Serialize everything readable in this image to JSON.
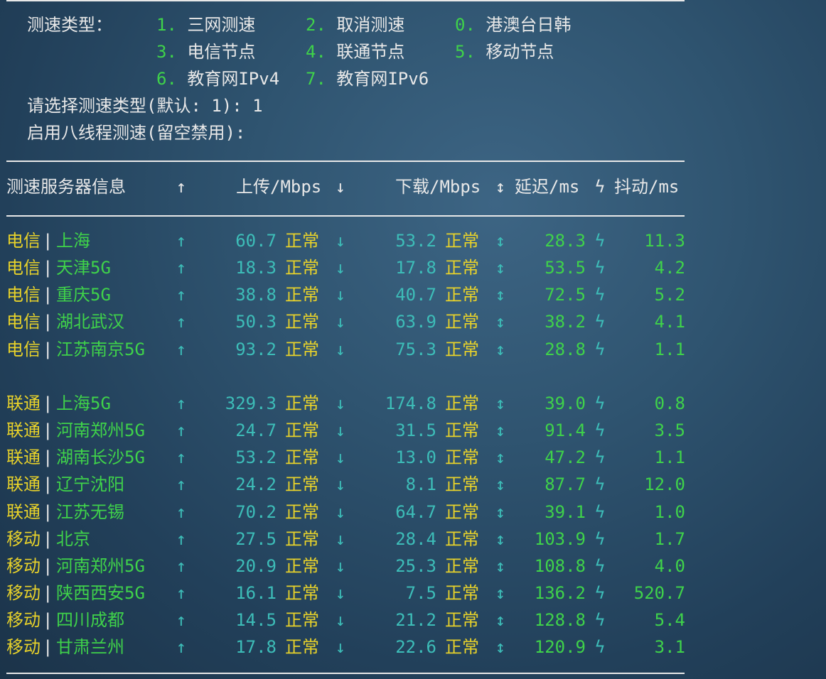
{
  "menu": {
    "label": "测速类型：",
    "options": [
      {
        "key": "1.",
        "text": "三网测速"
      },
      {
        "key": "2.",
        "text": "取消测速"
      },
      {
        "key": "0.",
        "text": "港澳台日韩"
      },
      {
        "key": "3.",
        "text": "电信节点"
      },
      {
        "key": "4.",
        "text": "联通节点"
      },
      {
        "key": "5.",
        "text": "移动节点"
      },
      {
        "key": "6.",
        "text": "教育网IPv4"
      },
      {
        "key": "7.",
        "text": "教育网IPv6"
      }
    ],
    "prompt_select": "请选择测速类型(默认: 1): 1",
    "prompt_threads": "启用八线程测速(留空禁用):"
  },
  "table": {
    "headers": {
      "server": "测速服务器信息",
      "up_icon": "↑",
      "upload": "上传/Mbps",
      "down_icon": "↓",
      "download": "下载/Mbps",
      "lat_icon": "↕",
      "latency": "延迟/ms",
      "jit_icon": "ϟ",
      "jitter": "抖动/ms"
    },
    "status_text": "正常",
    "groups": [
      {
        "rows": [
          {
            "isp": "电信",
            "node": "上海",
            "up": "60.7",
            "down": "53.2",
            "lat": "28.3",
            "jit": "11.3"
          },
          {
            "isp": "电信",
            "node": "天津5G",
            "up": "18.3",
            "down": "17.8",
            "lat": "53.5",
            "jit": "4.2"
          },
          {
            "isp": "电信",
            "node": "重庆5G",
            "up": "38.8",
            "down": "40.7",
            "lat": "72.5",
            "jit": "5.2"
          },
          {
            "isp": "电信",
            "node": "湖北武汉",
            "up": "50.3",
            "down": "63.9",
            "lat": "38.2",
            "jit": "4.1"
          },
          {
            "isp": "电信",
            "node": "江苏南京5G",
            "up": "93.2",
            "down": "75.3",
            "lat": "28.8",
            "jit": "1.1"
          }
        ]
      },
      {
        "rows": [
          {
            "isp": "联通",
            "node": "上海5G",
            "up": "329.3",
            "down": "174.8",
            "lat": "39.0",
            "jit": "0.8"
          },
          {
            "isp": "联通",
            "node": "河南郑州5G",
            "up": "24.7",
            "down": "31.5",
            "lat": "91.4",
            "jit": "3.5"
          },
          {
            "isp": "联通",
            "node": "湖南长沙5G",
            "up": "53.2",
            "down": "13.0",
            "lat": "47.2",
            "jit": "1.1"
          },
          {
            "isp": "联通",
            "node": "辽宁沈阳",
            "up": "24.2",
            "down": "8.1",
            "lat": "87.7",
            "jit": "12.0"
          },
          {
            "isp": "联通",
            "node": "江苏无锡",
            "up": "70.2",
            "down": "64.7",
            "lat": "39.1",
            "jit": "1.0"
          },
          {
            "isp": "移动",
            "node": "北京",
            "up": "27.5",
            "down": "28.4",
            "lat": "103.9",
            "jit": "1.7"
          },
          {
            "isp": "移动",
            "node": "河南郑州5G",
            "up": "20.9",
            "down": "25.3",
            "lat": "108.8",
            "jit": "4.0"
          },
          {
            "isp": "移动",
            "node": "陕西西安5G",
            "up": "16.1",
            "down": "7.5",
            "lat": "136.2",
            "jit": "520.7"
          },
          {
            "isp": "移动",
            "node": "四川成都",
            "up": "14.5",
            "down": "21.2",
            "lat": "128.8",
            "jit": "5.4"
          },
          {
            "isp": "移动",
            "node": "甘肃兰州",
            "up": "17.8",
            "down": "22.6",
            "lat": "120.9",
            "jit": "3.1"
          }
        ]
      }
    ]
  },
  "colors": {
    "background": "#2f5470",
    "text": "#e8e8e8",
    "green": "#3fd24a",
    "yellow": "#e8d22a",
    "cyan": "#3dbdb8"
  }
}
